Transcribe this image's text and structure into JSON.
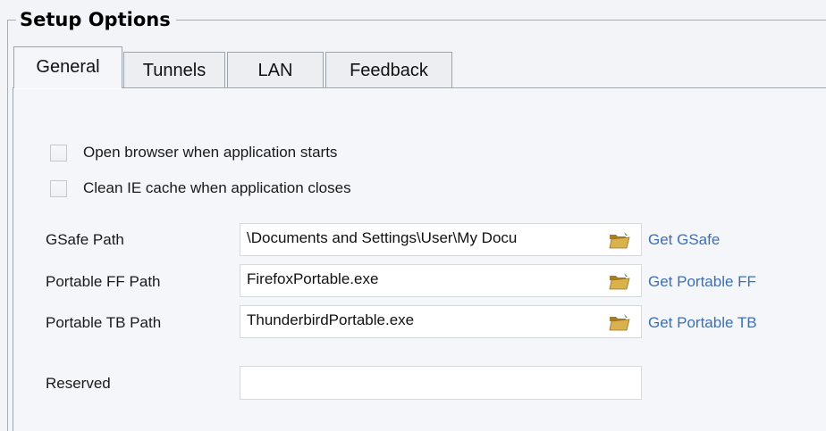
{
  "group": {
    "title": "Setup Options"
  },
  "tabs": [
    {
      "label": "General",
      "active": true
    },
    {
      "label": "Tunnels",
      "active": false
    },
    {
      "label": "LAN",
      "active": false
    },
    {
      "label": "Feedback",
      "active": false
    }
  ],
  "general": {
    "options": [
      {
        "label": "Open browser when application starts",
        "checked": false
      },
      {
        "label": "Clean IE cache when application closes",
        "checked": false
      }
    ],
    "fields": [
      {
        "label": "GSafe Path",
        "value": "\\Documents and Settings\\User\\My Docu",
        "icon": "folder-open-icon",
        "link": "Get GSafe"
      },
      {
        "label": "Portable FF Path",
        "value": "FirefoxPortable.exe",
        "icon": "folder-open-icon",
        "link": "Get Portable FF"
      },
      {
        "label": "Portable TB Path",
        "value": "ThunderbirdPortable.exe",
        "icon": "folder-open-icon",
        "link": "Get Portable TB"
      },
      {
        "label": "Reserved",
        "value": ""
      }
    ]
  },
  "colors": {
    "background": "#f2f4f7",
    "link": "#3c6fb6",
    "border": "#9ca3aa",
    "folder": "#c9a13d"
  }
}
